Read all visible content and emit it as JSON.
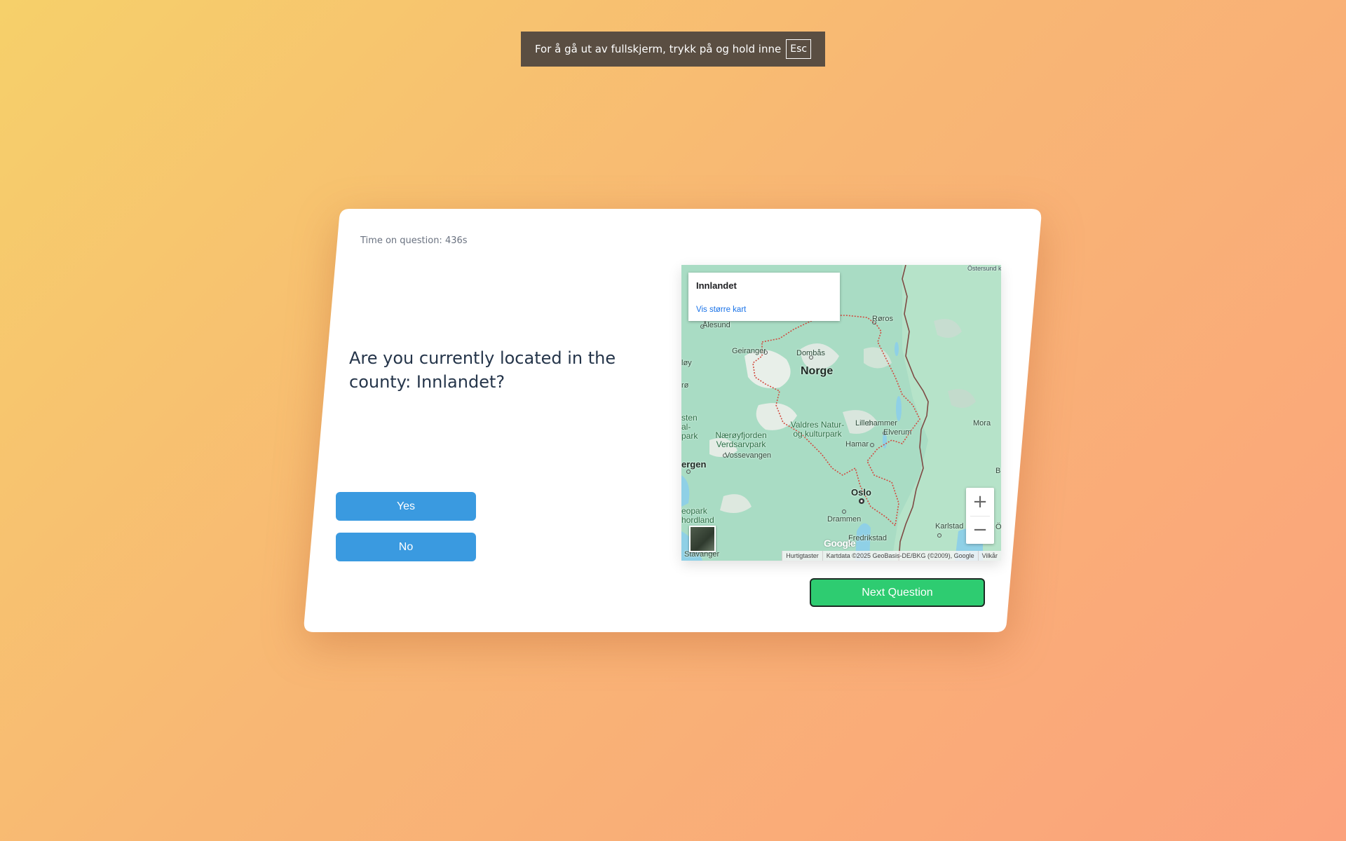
{
  "fullscreen_notice": {
    "text": "For å gå ut av fullskjerm, trykk på og hold inne",
    "key": "Esc"
  },
  "card": {
    "timer_text": "Time on question: 436s",
    "question": "Are you currently located in the county: Innlandet?",
    "answers": {
      "yes": "Yes",
      "no": "No"
    },
    "next_button": "Next Question"
  },
  "map": {
    "info_box": {
      "title": "Innlandet",
      "link": "Vis større kart"
    },
    "labels": {
      "country": "Norge",
      "oslo": "Oslo",
      "alesund": "Ålesund",
      "geiranger": "Geiranger",
      "dombas": "Dombås",
      "roros": "Røros",
      "ostersund": "Östersund kommun",
      "valdres": "Valdres Natur- og kulturpark",
      "naeroy": "Nærøyfjorden Verdsarvpark",
      "vossevangen": "Vossevangen",
      "lillehammer": "Lillehammer",
      "elverum": "Elverum",
      "hamar": "Hamar",
      "mora": "Mora",
      "bergen": "ergen",
      "drammen": "Drammen",
      "fredrikstad": "Fredrikstad",
      "karlstad": "Karlstad",
      "stavanger": "Stavanger",
      "geopark": "eopark hordland",
      "sten": "sten al- park",
      "loy": "løy",
      "ro": "rø",
      "b": "B",
      "o": "Ö"
    },
    "zoom_in": "+",
    "zoom_out": "−",
    "google_logo": "Google",
    "attribution": {
      "shortcuts": "Hurtigtaster",
      "data": "Kartdata ©2025 GeoBasis-DE/BKG (©2009), Google",
      "terms": "Vilkår"
    }
  },
  "colors": {
    "answer_button": "#3a9ae0",
    "next_button": "#2ecc71",
    "question_text": "#25354a",
    "map_link": "#1a73e8"
  }
}
